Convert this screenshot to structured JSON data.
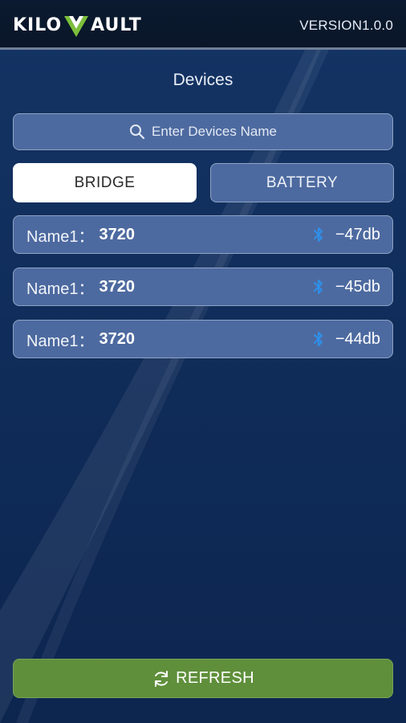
{
  "header": {
    "logo_text": "KILOVAULT",
    "logo_left": "KILO",
    "logo_right": "AULT",
    "version": "VERSION1.0.0"
  },
  "page": {
    "title": "Devices"
  },
  "search": {
    "placeholder": "Enter Devices Name",
    "icon": "search-icon"
  },
  "tabs": [
    {
      "label": "BRIDGE",
      "selected": true
    },
    {
      "label": "BATTERY",
      "selected": false
    }
  ],
  "devices": [
    {
      "label": "Name1：",
      "name": "3720",
      "rssi": "−47db",
      "icon": "bluetooth-icon"
    },
    {
      "label": "Name1：",
      "name": "3720",
      "rssi": "−45db",
      "icon": "bluetooth-icon"
    },
    {
      "label": "Name1：",
      "name": "3720",
      "rssi": "−44db",
      "icon": "bluetooth-icon"
    }
  ],
  "refresh": {
    "label": "REFRESH",
    "icon": "refresh-icon"
  },
  "colors": {
    "background": "#0f2a57",
    "header": "#0a1628",
    "button": "#4d6aa0",
    "selected_tab": "#ffffff",
    "refresh": "#5f8f3b",
    "logo_accent": "#7cbf3a",
    "bluetooth": "#2f8fe8"
  }
}
